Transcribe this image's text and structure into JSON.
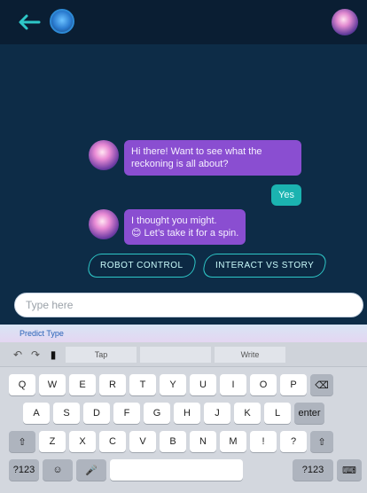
{
  "header": {
    "back_icon": "arrow-left-icon",
    "logo_icon": "robot-logo-icon",
    "profile_icon": "profile-avatar-icon"
  },
  "chat": {
    "messages": [
      {
        "from": "bot",
        "text": "Hi there! Want to see what the reckoning is all about?"
      },
      {
        "from": "user",
        "text": "Yes"
      },
      {
        "from": "bot",
        "text": "I thought you might.\n😊 Let’s take it for a spin."
      }
    ],
    "quick_replies": [
      "ROBOT CONTROL",
      "INTERACT VS STORY"
    ]
  },
  "input": {
    "placeholder": "Type here"
  },
  "keyboard": {
    "top_hint": "Predict Type",
    "suggestions": [
      "Tap",
      "",
      "Write"
    ],
    "row1": [
      "Q",
      "W",
      "E",
      "R",
      "T",
      "Y",
      "U",
      "I",
      "O",
      "P",
      "⌫"
    ],
    "row2": [
      "A",
      "S",
      "D",
      "F",
      "G",
      "H",
      "J",
      "K",
      "L",
      "enter"
    ],
    "row3": [
      "⇧",
      "Z",
      "X",
      "C",
      "V",
      "B",
      "N",
      "M",
      "!",
      "?",
      "⇧"
    ],
    "row4": {
      "left": [
        "?123",
        "☺",
        "🎤"
      ],
      "space": "",
      "right": [
        "?123",
        "⌨"
      ]
    }
  }
}
